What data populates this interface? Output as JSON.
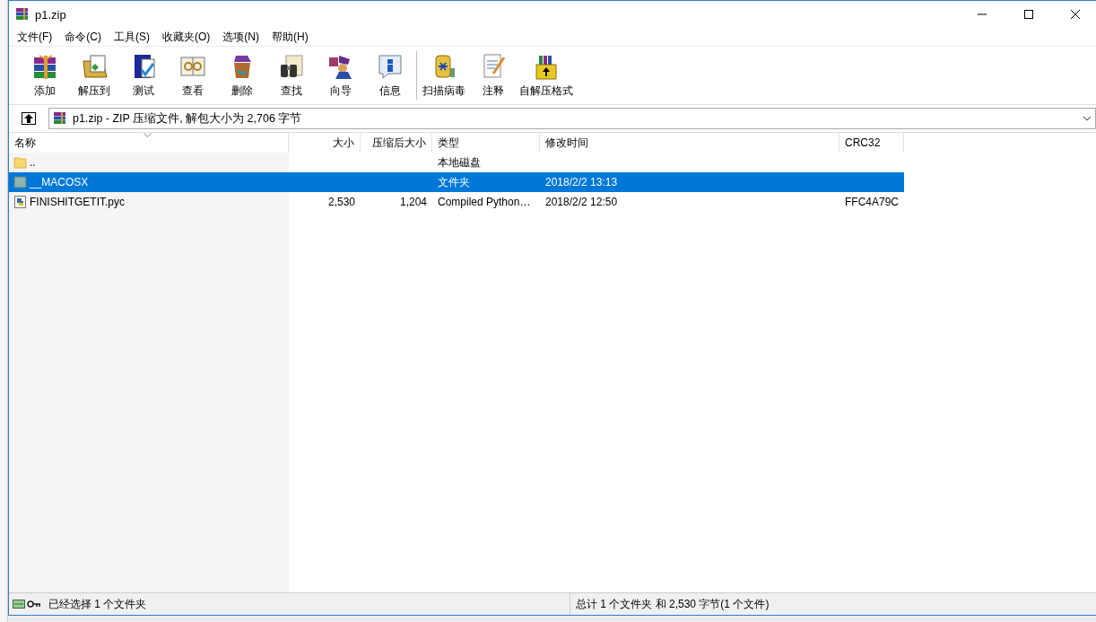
{
  "window": {
    "title": "p1.zip"
  },
  "menu": [
    "文件(F)",
    "命令(C)",
    "工具(S)",
    "收藏夹(O)",
    "选项(N)",
    "帮助(H)"
  ],
  "toolbar": [
    {
      "label": "添加",
      "kind": "add"
    },
    {
      "label": "解压到",
      "kind": "extract"
    },
    {
      "label": "测试",
      "kind": "test"
    },
    {
      "label": "查看",
      "kind": "view"
    },
    {
      "label": "删除",
      "kind": "delete"
    },
    {
      "label": "查找",
      "kind": "find"
    },
    {
      "label": "向导",
      "kind": "wizard"
    },
    {
      "label": "信息",
      "kind": "info"
    },
    {
      "label": "扫描病毒",
      "kind": "scan",
      "group_start": true
    },
    {
      "label": "注释",
      "kind": "comment"
    },
    {
      "label": "自解压格式",
      "kind": "sfx"
    }
  ],
  "address": {
    "path": "p1.zip - ZIP 压缩文件, 解包大小为 2,706 字节"
  },
  "table": {
    "columns": [
      {
        "label": "名称",
        "sorted": true
      },
      {
        "label": "大小",
        "sorted": false
      },
      {
        "label": "压缩后大小",
        "sorted": false
      },
      {
        "label": "类型",
        "sorted": false
      },
      {
        "label": "修改时间",
        "sorted": false
      },
      {
        "label": "CRC32",
        "sorted": false
      }
    ],
    "rows": [
      {
        "kind": "up",
        "selected": false,
        "cells": [
          "..",
          "",
          "",
          "本地磁盘",
          "",
          ""
        ]
      },
      {
        "kind": "folder",
        "selected": true,
        "cells": [
          "__MACOSX",
          "",
          "",
          "文件夹",
          "2018/2/2 13:13",
          ""
        ]
      },
      {
        "kind": "python",
        "selected": false,
        "cells": [
          "FINISHITGETIT.pyc",
          "2,530",
          "1,204",
          "Compiled Python…",
          "2018/2/2 12:50",
          "FFC4A79C"
        ]
      }
    ]
  },
  "status_bar": {
    "left": "已经选择 1 个文件夹",
    "right": "总计 1 个文件夹 和 2,530 字节(1 个文件)"
  }
}
